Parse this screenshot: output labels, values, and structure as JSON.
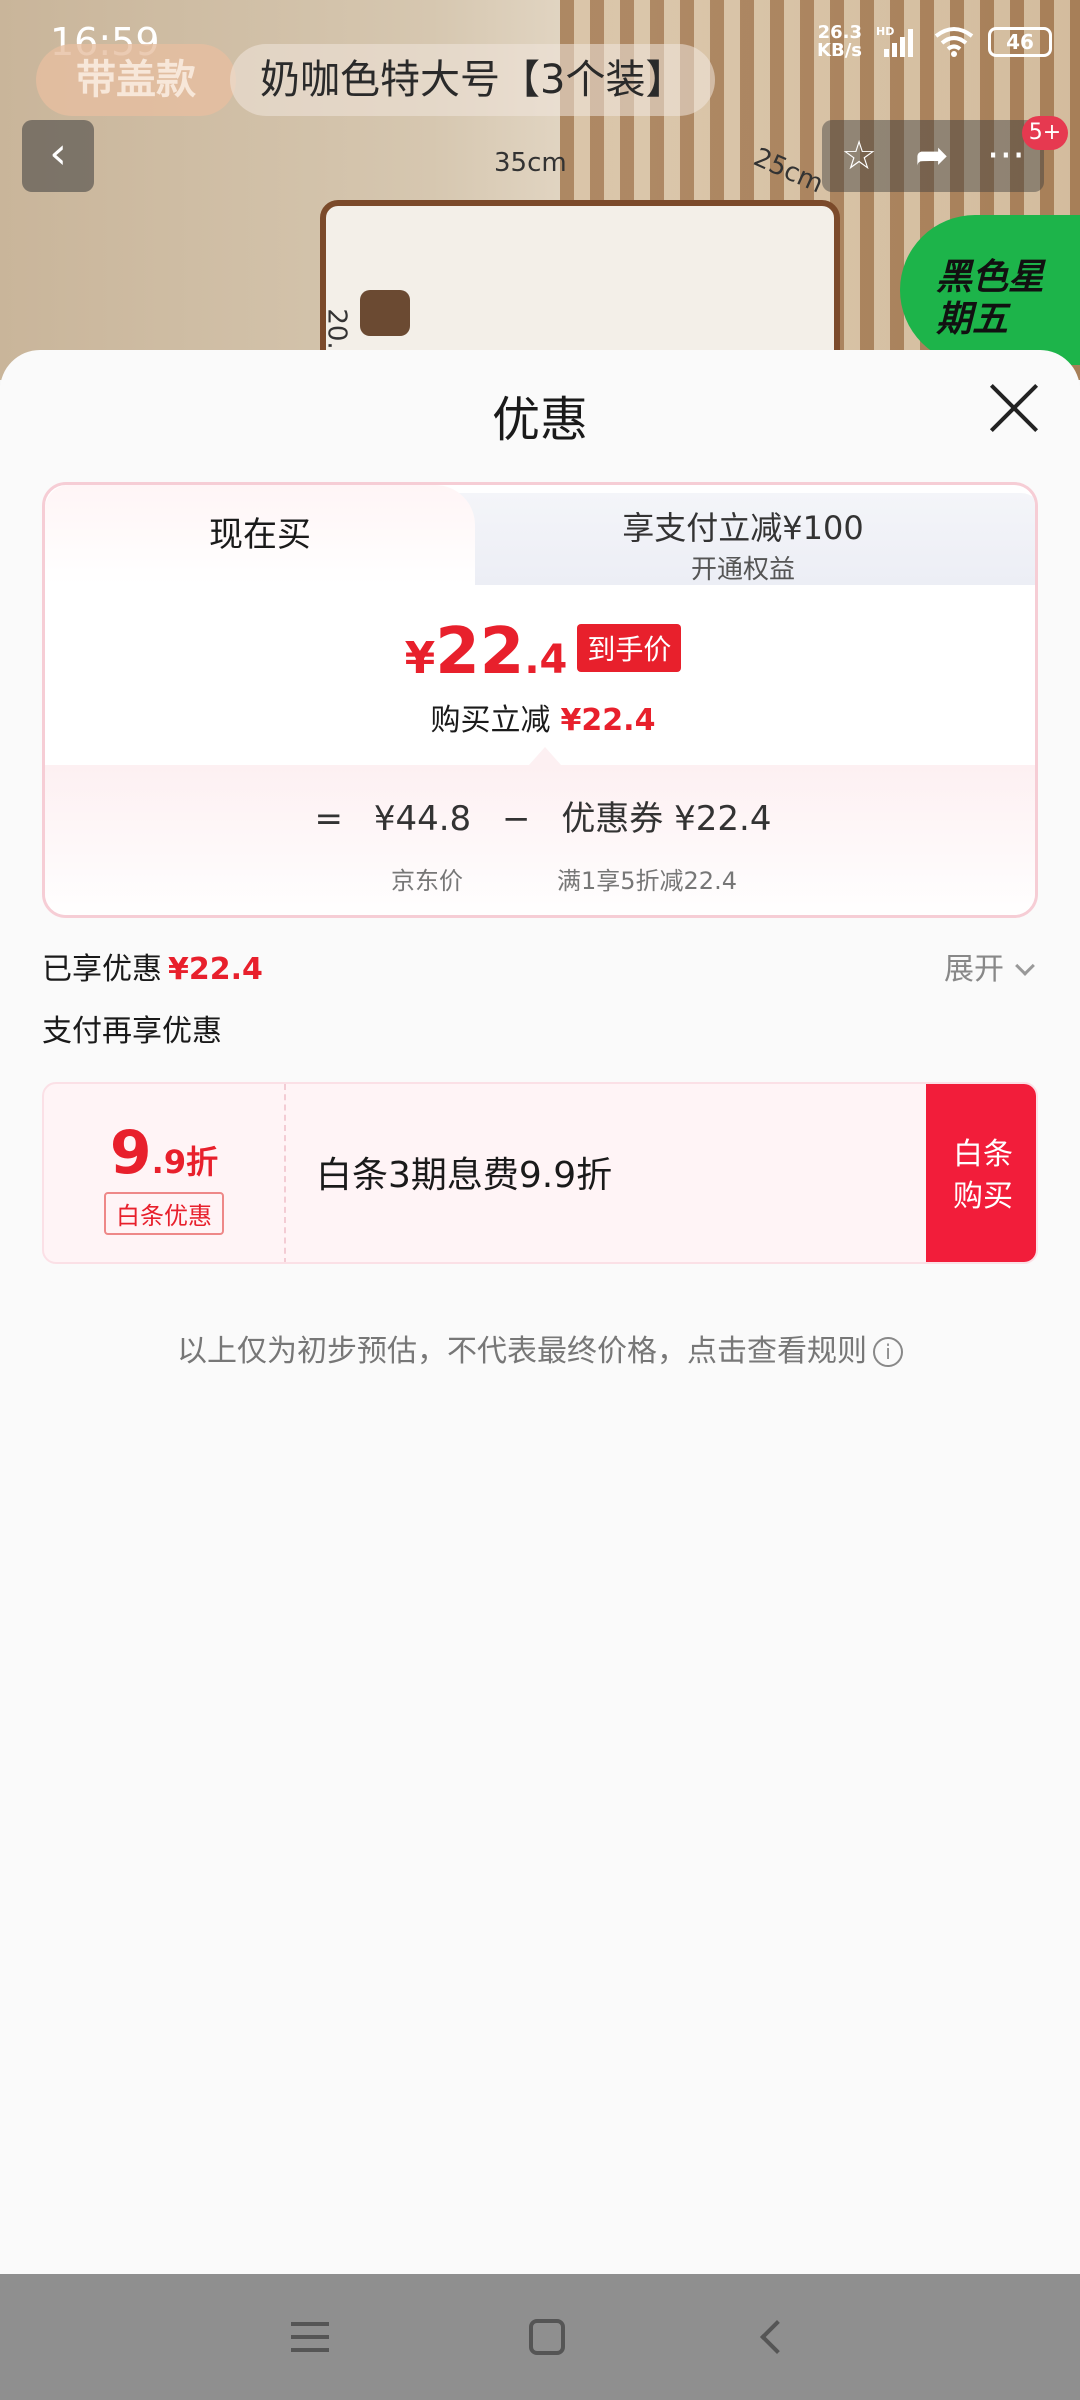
{
  "status_bar": {
    "time": "16:59",
    "net_speed_top": "26.3",
    "net_speed_bottom": "KB/s",
    "hd": "HD",
    "battery": "46"
  },
  "product_header": {
    "variant_pill": "带盖款",
    "variant_title": "奶咖色特大号【3个装】",
    "badge_count": "5+",
    "dim_width": "35cm",
    "dim_depth": "25cm",
    "dim_height": "20.",
    "promo_badge": "黑色星期五"
  },
  "sheet": {
    "title": "优惠",
    "tabs": {
      "active": "现在买",
      "inactive_main": "享支付立减¥100",
      "inactive_sub": "开通权益"
    },
    "final_price": {
      "yen": "¥",
      "integer": "22",
      "decimal": ".4",
      "tag": "到手价"
    },
    "instant": {
      "label": "购买立减",
      "amount": "¥22.4"
    },
    "breakdown": {
      "eq": "=",
      "jd_price": "¥44.8",
      "minus": "−",
      "coupon": "优惠券 ¥22.4",
      "jd_label": "京东价",
      "coupon_label": "满1享5折减22.4"
    },
    "enjoyed": {
      "label": "已享优惠",
      "amount": "¥22.4"
    },
    "expand": "展开",
    "pay_again": "支付再享优惠",
    "promo": {
      "disc_big": "9",
      "disc_small": ".9折",
      "disc_tag": "白条优惠",
      "desc": "白条3期息费9.9折",
      "buy_line1": "白条",
      "buy_line2": "购买"
    },
    "disclaimer": "以上仅为初步预估，不代表最终价格，点击查看规则"
  },
  "colors": {
    "accent": "#e8202c",
    "buy_button": "#f21d3a"
  }
}
